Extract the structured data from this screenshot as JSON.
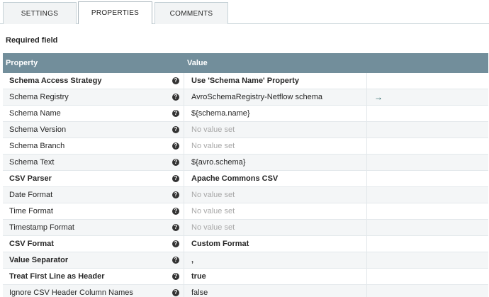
{
  "tabs": [
    {
      "label": "SETTINGS"
    },
    {
      "label": "PROPERTIES"
    },
    {
      "label": "COMMENTS"
    }
  ],
  "required_label": "Required field",
  "table": {
    "headers": {
      "property": "Property",
      "value": "Value"
    },
    "help_glyph": "?",
    "goto_glyph": "→",
    "rows": [
      {
        "name": "Schema Access Strategy",
        "value": "Use 'Schema Name' Property"
      },
      {
        "name": "Schema Registry",
        "value": "AvroSchemaRegistry-Netflow schema"
      },
      {
        "name": "Schema Name",
        "value": "${schema.name}"
      },
      {
        "name": "Schema Version",
        "value": "No value set"
      },
      {
        "name": "Schema Branch",
        "value": "No value set"
      },
      {
        "name": "Schema Text",
        "value": "${avro.schema}"
      },
      {
        "name": "CSV Parser",
        "value": "Apache Commons CSV"
      },
      {
        "name": "Date Format",
        "value": "No value set"
      },
      {
        "name": "Time Format",
        "value": "No value set"
      },
      {
        "name": "Timestamp Format",
        "value": "No value set"
      },
      {
        "name": "CSV Format",
        "value": "Custom Format"
      },
      {
        "name": "Value Separator",
        "value": ","
      },
      {
        "name": "Treat First Line as Header",
        "value": "true"
      },
      {
        "name": "Ignore CSV Header Column Names",
        "value": "false"
      }
    ]
  }
}
